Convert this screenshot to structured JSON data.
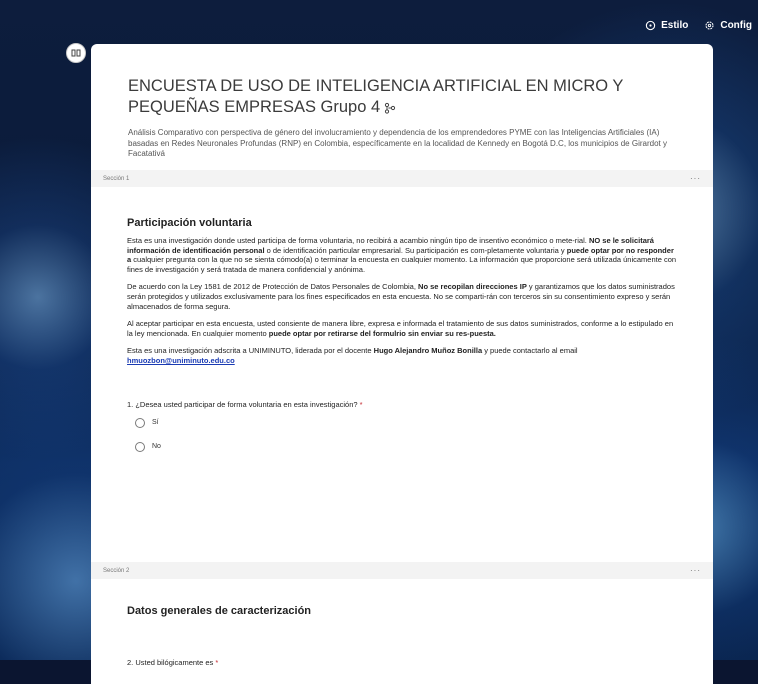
{
  "topbar": {
    "style_label": "Estilo",
    "settings_label": "Config"
  },
  "form": {
    "title": "ENCUESTA DE USO DE INTELIGENCIA ARTIFICIAL EN MICRO Y PEQUEÑAS EMPRESAS Grupo 4",
    "description": "Análisis Comparativo con perspectiva de género del involucramiento y dependencia de los emprendedores PYME con las Inteligencias Artificiales (IA) basadas en Redes Neuronales Profundas (RNP) en Colombia, específicamente en la localidad de Kennedy en Bogotá D.C, los municipios de Girardot y Facatativá"
  },
  "section1": {
    "label": "Sección 1",
    "menu": "···",
    "heading": "Participación voluntaria",
    "p1_a": "Esta es una investigación donde usted participa de forma voluntaria, no recibirá a acambio ningún tipo de insentivo económico o mete-rial. ",
    "p1_b": "NO se le solicitará información de identificación personal",
    "p1_c": " o de identificación particular empresarial.  Su participación es com-pletamente voluntaria y ",
    "p1_d": "puede optar por no responder a",
    "p1_e": " cualquier pregunta con la que no se sienta cómodo(a) o terminar la encuesta en cualquier momento. La información que proporcione será utilizada únicamente con fines de investigación y será tratada de manera confidencial y anónima.",
    "p2_a": "De acuerdo con la Ley 1581 de 2012 de Protección de Datos Personales de Colombia, ",
    "p2_b": "No se recopilan direcciones IP",
    "p2_c": " y garantizamos que los datos suministrados serán protegidos y utilizados exclusivamente para los fines especificados en esta encuesta. No se comparti-rán con terceros sin su consentimiento expreso y serán almacenados de forma segura.",
    "p3_a": "Al aceptar participar en esta encuesta, usted consiente de manera libre, expresa e informada el tratamiento de sus datos suministrados, conforme a lo estipulado en la ley mencionada. En cualquier momento ",
    "p3_b": "puede optar por retirarse del formulrio sin enviar  su res-puesta.",
    "p4_a": "Esta es una investigación adscrita a UNIMINUTO, liderada por el docente ",
    "p4_b": "Hugo Alejandro Muñoz Bonilla",
    "p4_c": " y puede contactarlo al email ",
    "email": "hmuozbon@uniminuto.edu.co",
    "question": "1. ¿Desea usted participar de forma voluntaria en esta investigación?",
    "required_mark": "*",
    "options": [
      "Sí",
      "No"
    ]
  },
  "section2": {
    "label": "Sección 2",
    "menu": "···",
    "heading": "Datos generales de caracterización",
    "question": "2. Usted bilógicamente es",
    "required_mark": "*"
  },
  "colors": {
    "accent_blue": "#1a3bb3",
    "required_red": "#c4262e",
    "background_navy": "#0b1530"
  },
  "icons": [
    "style-icon",
    "settings-icon",
    "collapse-icon",
    "branch-icon"
  ]
}
